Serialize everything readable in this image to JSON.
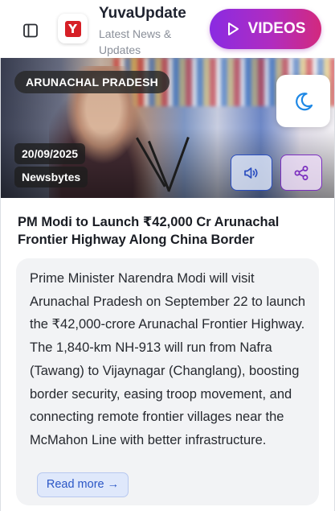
{
  "header": {
    "brand": "YuvaUpdate",
    "tagline": "Latest News & Updates",
    "logo_letter": "Y",
    "videos_label": "VIDEOS",
    "sidebar_icon": "sidebar-toggle-icon",
    "videos_icon": "play-icon"
  },
  "article": {
    "category": "ARUNACHAL PRADESH",
    "date": "20/09/2025",
    "source": "Newsbytes",
    "headline": "PM Modi to Launch ₹42,000 Cr Arunachal Frontier Highway Along China Border",
    "summary": "Prime Minister Narendra Modi will visit Arunachal Pradesh on September 22 to launch the ₹42,000-crore Arunachal Frontier Highway. The 1,840-km NH-913 will run from Nafra (Tawang) to Vijaynagar (Changlang), boosting border security, easing troop movement, and connecting remote frontier villages near the McMahon Line with better infrastructure.",
    "read_more": "Read more →",
    "theme_icon": "moon-icon",
    "audio_icon": "speaker-icon",
    "share_icon": "share-icon"
  },
  "colors": {
    "accent_gradient_start": "#8a2be2",
    "accent_gradient_end": "#d3297d",
    "logo_red": "#d61f26",
    "link_blue": "#2a56c6",
    "theme_icon": "#1e88e5"
  }
}
